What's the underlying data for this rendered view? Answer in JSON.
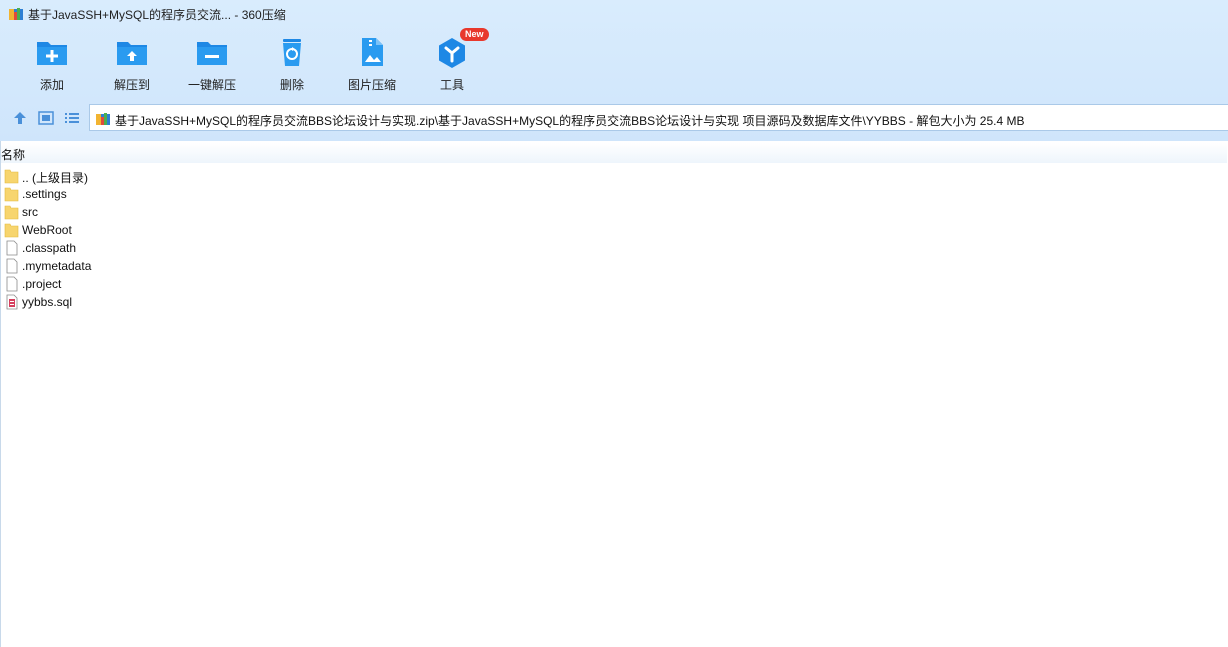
{
  "window": {
    "title": "基于JavaSSH+MySQL的程序员交流... - 360压缩"
  },
  "toolbar": {
    "items": [
      {
        "label": "添加",
        "icon": "add-folder-icon"
      },
      {
        "label": "解压到",
        "icon": "extract-to-icon"
      },
      {
        "label": "一键解压",
        "icon": "one-click-extract-icon"
      },
      {
        "label": "删除",
        "icon": "recycle-delete-icon"
      },
      {
        "label": "图片压缩",
        "icon": "image-compress-icon"
      },
      {
        "label": "工具",
        "icon": "tools-icon",
        "badge": "New"
      }
    ]
  },
  "nav": {
    "path": "基于JavaSSH+MySQL的程序员交流BBS论坛设计与实现.zip\\基于JavaSSH+MySQL的程序员交流BBS论坛设计与实现 项目源码及数据库文件\\YYBBS - 解包大小为 25.4 MB"
  },
  "list": {
    "column_name": "名称",
    "files": [
      {
        "name": ".. (上级目录)",
        "type": "folder"
      },
      {
        "name": ".settings",
        "type": "folder"
      },
      {
        "name": "src",
        "type": "folder"
      },
      {
        "name": "WebRoot",
        "type": "folder"
      },
      {
        "name": ".classpath",
        "type": "file"
      },
      {
        "name": ".mymetadata",
        "type": "file"
      },
      {
        "name": ".project",
        "type": "file"
      },
      {
        "name": "yybbs.sql",
        "type": "sql"
      }
    ]
  },
  "colors": {
    "accent": "#2a8fe6",
    "chrome_bg": "#d3e8fc",
    "badge": "#e8382c",
    "folder": "#f7d56e"
  }
}
